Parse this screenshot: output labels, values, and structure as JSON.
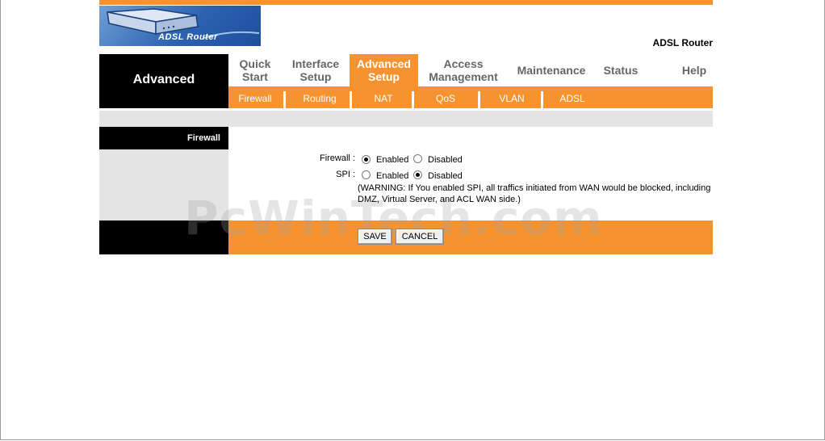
{
  "header": {
    "logo_text": "ADSL Router",
    "product_name": "ADSL Router"
  },
  "section_title": "Advanced",
  "menu": [
    {
      "label_line1": "Quick",
      "label_line2": "Start",
      "active": false
    },
    {
      "label_line1": "Interface",
      "label_line2": "Setup",
      "active": false
    },
    {
      "label_line1": "Advanced",
      "label_line2": "Setup",
      "active": true
    },
    {
      "label_line1": "Access",
      "label_line2": "Management",
      "active": false
    },
    {
      "label_line1": "Maintenance",
      "label_line2": "",
      "active": false
    },
    {
      "label_line1": "Status",
      "label_line2": "",
      "active": false
    },
    {
      "label_line1": "Help",
      "label_line2": "",
      "active": false
    }
  ],
  "submenu": [
    "Firewall",
    "Routing",
    "NAT",
    "QoS",
    "VLAN",
    "ADSL"
  ],
  "sidebar": {
    "current_page": "Firewall"
  },
  "form": {
    "firewall": {
      "label": "Firewall :",
      "options": [
        "Enabled",
        "Disabled"
      ],
      "selected": "Enabled"
    },
    "spi": {
      "label": "SPI :",
      "options": [
        "Enabled",
        "Disabled"
      ],
      "selected": "Disabled"
    },
    "warning": "(WARNING: If You enabled SPI, all traffics initiated from WAN would be blocked, including DMZ, Virtual Server, and ACL WAN side.)"
  },
  "buttons": {
    "save": "SAVE",
    "cancel": "CANCEL"
  },
  "watermark": "PcWinTech.com",
  "colors": {
    "accent_orange": "#f7932f",
    "panel_black": "#000000",
    "panel_gray": "#e4e4e4",
    "menu_text": "#666666"
  }
}
